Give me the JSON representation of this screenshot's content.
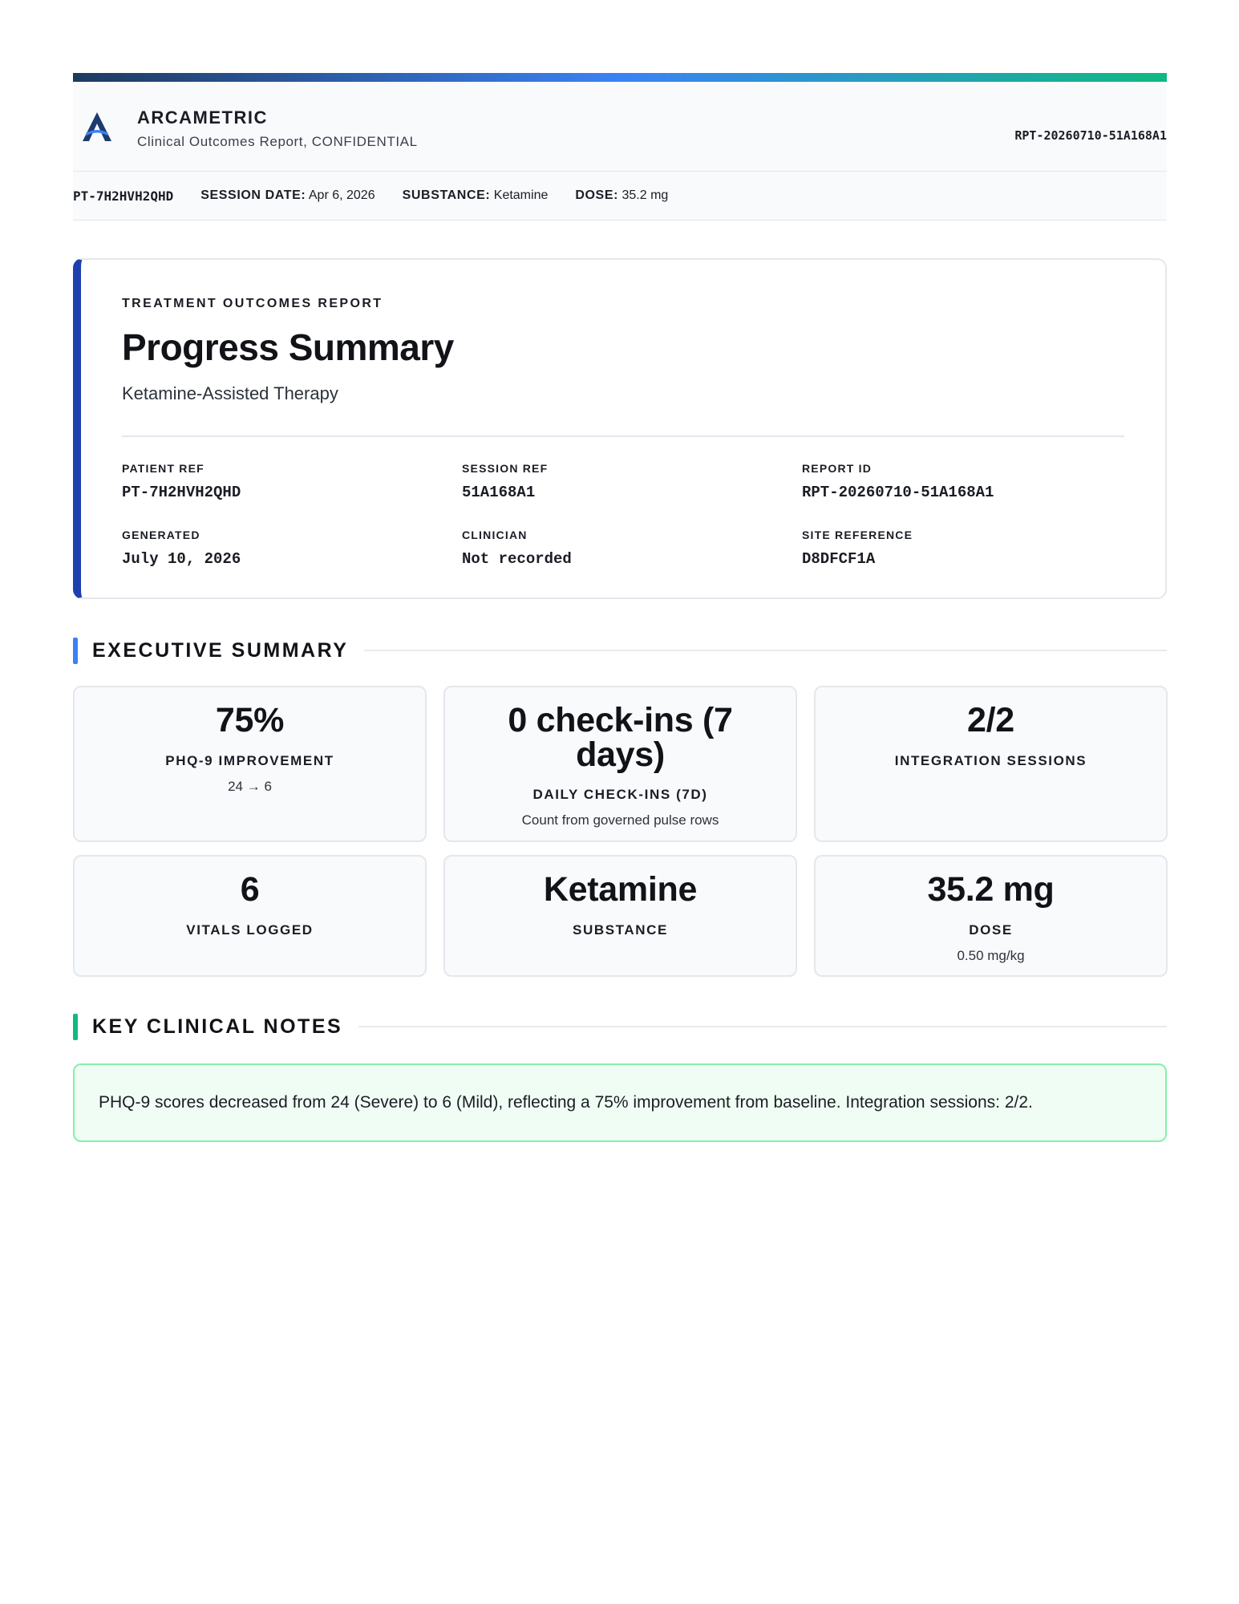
{
  "header": {
    "brand": "ARCAMETRIC",
    "subtitle": "Clinical Outcomes Report, CONFIDENTIAL",
    "report_id": "RPT-20260710-51A168A1",
    "logo_icon": "arcametric-a-logo-icon"
  },
  "meta": {
    "patient": "PT-7H2HVH2QHD",
    "session_date_label": "SESSION DATE:",
    "session_date": "Apr 6, 2026",
    "substance_label": "SUBSTANCE:",
    "substance": "Ketamine",
    "dose_label": "DOSE:",
    "dose": "35.2 mg"
  },
  "hero": {
    "kicker": "TREATMENT OUTCOMES REPORT",
    "title": "Progress Summary",
    "subtitle": "Ketamine-Assisted Therapy",
    "fields": [
      {
        "label": "PATIENT REF",
        "value": "PT-7H2HVH2QHD"
      },
      {
        "label": "SESSION REF",
        "value": "51A168A1"
      },
      {
        "label": "REPORT ID",
        "value": "RPT-20260710-51A168A1"
      },
      {
        "label": "GENERATED",
        "value": "July 10, 2026"
      },
      {
        "label": "CLINICIAN",
        "value": "Not recorded"
      },
      {
        "label": "SITE REFERENCE",
        "value": "D8DFCF1A"
      }
    ]
  },
  "executive": {
    "title": "EXECUTIVE SUMMARY",
    "accent": "#3b82f6",
    "cards": [
      {
        "value": "75%",
        "label": "PHQ-9 IMPROVEMENT",
        "sub": "24 → 6"
      },
      {
        "value": "0 check-ins (7 days)",
        "label": "DAILY CHECK-INS (7D)",
        "sub": "Count from governed pulse rows"
      },
      {
        "value": "2/2",
        "label": "INTEGRATION SESSIONS",
        "sub": ""
      },
      {
        "value": "6",
        "label": "VITALS LOGGED",
        "sub": ""
      },
      {
        "value": "Ketamine",
        "label": "SUBSTANCE",
        "sub": ""
      },
      {
        "value": "35.2 mg",
        "label": "DOSE",
        "sub": "0.50 mg/kg"
      }
    ]
  },
  "notes": {
    "title": "KEY CLINICAL NOTES",
    "accent": "#10b981",
    "text": "PHQ-9 scores decreased from 24 (Severe) to 6 (Mild), reflecting a 75% improvement from baseline. Integration sessions: 2/2."
  },
  "colors": {
    "hero_accent": "#1e40af",
    "notes_bg": "#f0fdf4",
    "notes_border": "#86efac"
  }
}
